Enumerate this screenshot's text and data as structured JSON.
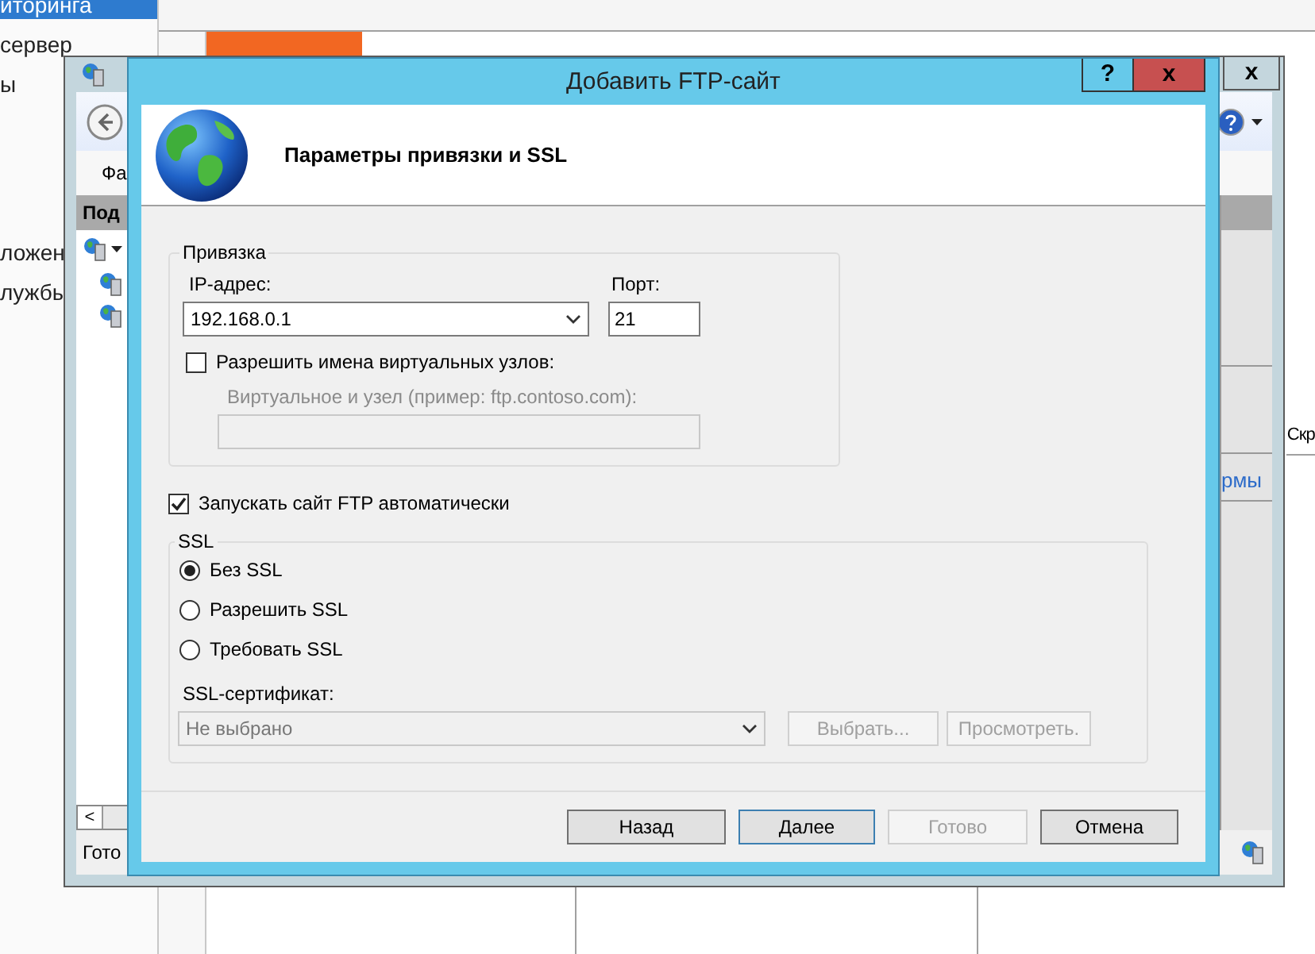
{
  "background": {
    "sidebar_top": [
      {
        "label": "иторинга",
        "selected": true
      },
      {
        "label": "сервер",
        "selected": false
      },
      {
        "label": "ы",
        "selected": false
      }
    ],
    "sidebar_bottom": [
      {
        "label": "ложен",
        "selected": false
      },
      {
        "label": "лужбы",
        "selected": false
      }
    ],
    "side_text": "Скр"
  },
  "manager_window": {
    "close_button": "x",
    "menu_item": "Фа",
    "pane_header": "Под",
    "actions_link": "рмы",
    "status": "Гото",
    "scroll_button": "<"
  },
  "dialog": {
    "title": "Добавить FTP-сайт",
    "help_button": "?",
    "close_button": "x",
    "heading": "Параметры привязки и SSL",
    "binding": {
      "legend": "Привязка",
      "ip_label": "IP-адрес:",
      "ip_value": "192.168.0.1",
      "port_label": "Порт:",
      "port_value": "21",
      "virtual_hosts": {
        "label": "Разрешить имена виртуальных узлов:",
        "checked": false
      },
      "host_label": "Виртуальное и узел (пример: ftp.contoso.com):",
      "host_disabled": true
    },
    "autostart": {
      "label": "Запускать сайт FTP автоматически",
      "checked": true
    },
    "ssl": {
      "legend": "SSL",
      "options": [
        {
          "label": "Без SSL",
          "selected": true
        },
        {
          "label": "Разрешить SSL",
          "selected": false
        },
        {
          "label": "Требовать SSL",
          "selected": false
        }
      ],
      "cert_label": "SSL-сертификат:",
      "cert_value": "Не выбрано",
      "cert_disabled": true,
      "cert_buttons": [
        {
          "label": "Выбрать...",
          "disabled": true
        },
        {
          "label": "Просмотреть.",
          "disabled": true
        }
      ]
    },
    "buttons": [
      {
        "label": "Назад",
        "disabled": false,
        "focused": false
      },
      {
        "label": "Далее",
        "disabled": false,
        "focused": true
      },
      {
        "label": "Готово",
        "disabled": true,
        "focused": false
      },
      {
        "label": "Отмена",
        "disabled": false,
        "focused": false
      }
    ]
  }
}
